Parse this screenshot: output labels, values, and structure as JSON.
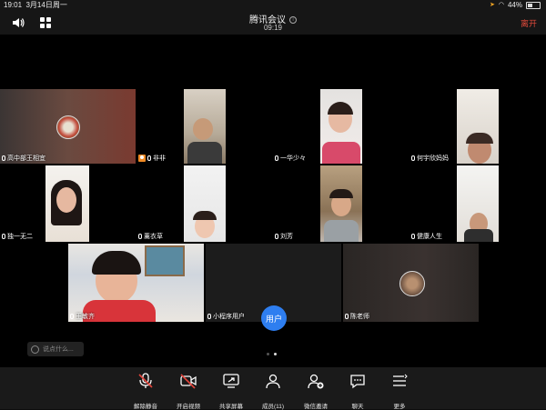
{
  "status_bar": {
    "time": "19:01",
    "date": "3月14日周一",
    "battery": "44%",
    "battery_level": 0.44
  },
  "header": {
    "title": "腾讯会议",
    "time": "09:19",
    "leave_label": "离开"
  },
  "participants": [
    {
      "name": "高中部王相宜"
    },
    {
      "name": "非非"
    },
    {
      "name": "一华少々"
    },
    {
      "name": "何宇欣妈妈"
    },
    {
      "name": "独一无二"
    },
    {
      "name": "薰衣草"
    },
    {
      "name": "刘芳"
    },
    {
      "name": "健康人生"
    },
    {
      "name": "王敏齐"
    },
    {
      "name": "小程序用户",
      "avatar_text": "用户"
    },
    {
      "name": "陈老师"
    }
  ],
  "chat": {
    "placeholder": "说点什么..."
  },
  "pages": {
    "count": 2,
    "current": 2
  },
  "toolbar": [
    {
      "label": "解除静音",
      "icon": "mic-muted-icon"
    },
    {
      "label": "开启视频",
      "icon": "video-off-icon"
    },
    {
      "label": "共享屏幕",
      "icon": "share-screen-icon"
    },
    {
      "label": "成员(11)",
      "icon": "members-icon"
    },
    {
      "label": "微信邀请",
      "icon": "invite-icon"
    },
    {
      "label": "聊天",
      "icon": "chat-icon"
    },
    {
      "label": "更多",
      "icon": "more-icon"
    }
  ],
  "colors": {
    "accent_blue": "#2e7ef0",
    "leave_red": "#e24a3b",
    "muted_red": "#e5453c",
    "background": "#000000"
  }
}
